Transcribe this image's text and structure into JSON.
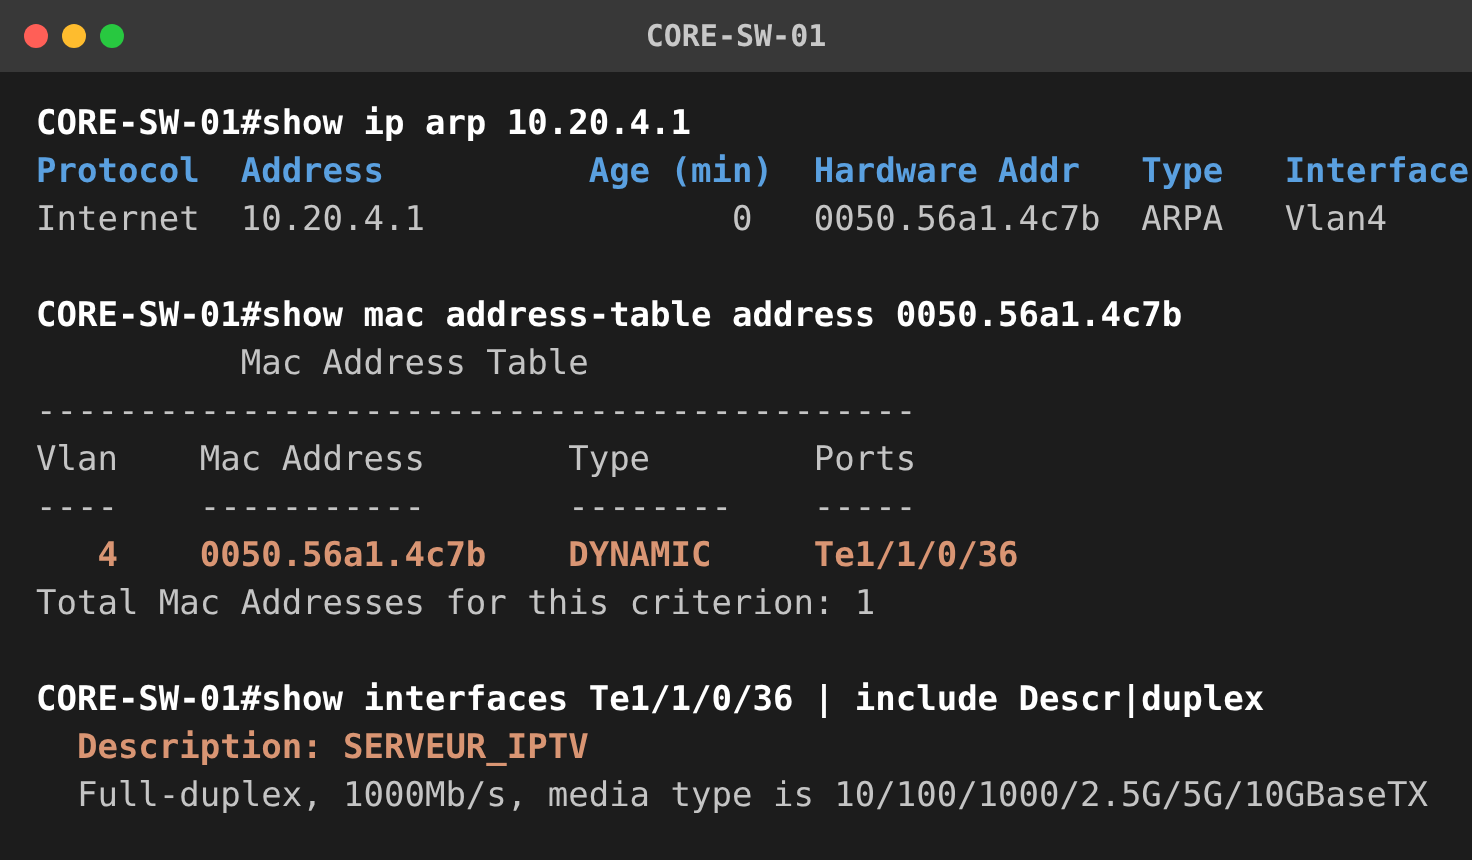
{
  "window": {
    "title": "CORE-SW-01"
  },
  "lines": [
    {
      "kind": "command",
      "text": "CORE-SW-01#show ip arp 10.20.4.1"
    },
    {
      "kind": "header",
      "text": "Protocol  Address          Age (min)  Hardware Addr   Type   Interface"
    },
    {
      "kind": "output",
      "text": "Internet  10.20.4.1               0   0050.56a1.4c7b  ARPA   Vlan4"
    },
    {
      "kind": "blank"
    },
    {
      "kind": "command",
      "text": "CORE-SW-01#show mac address-table address 0050.56a1.4c7b"
    },
    {
      "kind": "output",
      "text": "          Mac Address Table"
    },
    {
      "kind": "output",
      "text": "-------------------------------------------"
    },
    {
      "kind": "output",
      "text": "Vlan    Mac Address       Type        Ports"
    },
    {
      "kind": "output",
      "text": "----    -----------       --------    -----"
    },
    {
      "kind": "highlight",
      "text": "   4    0050.56a1.4c7b    DYNAMIC     Te1/1/0/36"
    },
    {
      "kind": "output",
      "text": "Total Mac Addresses for this criterion: 1"
    },
    {
      "kind": "blank"
    },
    {
      "kind": "command",
      "text": "CORE-SW-01#show interfaces Te1/1/0/36 | include Descr|duplex"
    },
    {
      "kind": "highlight",
      "text": "  Description: SERVEUR_IPTV"
    },
    {
      "kind": "output",
      "text": "  Full-duplex, 1000Mb/s, media type is 10/100/1000/2.5G/5G/10GBaseTX"
    }
  ]
}
